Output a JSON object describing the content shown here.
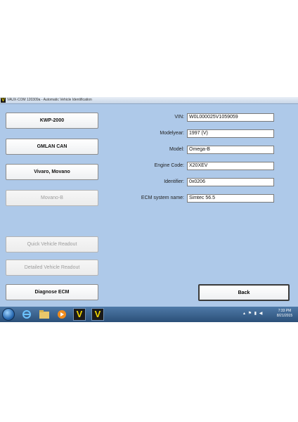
{
  "window": {
    "title": "VAUX-COM 120309a - Automatic Vehicle Identification",
    "logo_letter": "V"
  },
  "left_buttons": [
    {
      "label": "KWP-2000",
      "enabled": true
    },
    {
      "label": "GMLAN CAN",
      "enabled": true
    },
    {
      "label": "Vivaro, Movano",
      "enabled": true
    },
    {
      "label": "Movano-B",
      "enabled": false
    },
    {
      "label": "Quick Vehicle Readout",
      "enabled": false
    },
    {
      "label": "Detailed Vehicle Readout",
      "enabled": false
    },
    {
      "label": "Diagnose ECM",
      "enabled": true
    }
  ],
  "fields": [
    {
      "label": "VIN:",
      "value": "W0L000025V1059059"
    },
    {
      "label": "Modelyear:",
      "value": "1997 (V)"
    },
    {
      "label": "Model:",
      "value": "Omega-B"
    },
    {
      "label": "Engine Code:",
      "value": "X20XEV"
    },
    {
      "label": "Identifier:",
      "value": "0x0206"
    },
    {
      "label": "ECM system name:",
      "value": "Simtec 56.5"
    }
  ],
  "back_button": {
    "label": "Back"
  },
  "taskbar": {
    "app_letter": "V",
    "clock_time": "7:33 PM",
    "clock_date": "8/21/2015"
  },
  "colors": {
    "window_bg": "#aec9e9",
    "taskbar": "#2b4f78",
    "logo_yellow": "#f1d500"
  }
}
